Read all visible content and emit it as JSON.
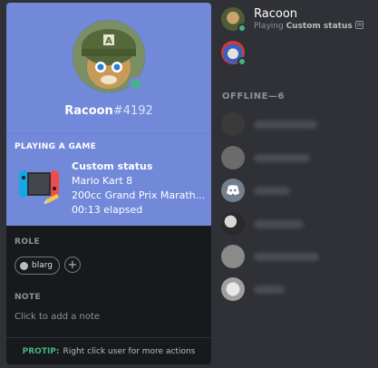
{
  "profile": {
    "username": "Racoon",
    "discriminator": "#4192",
    "status_color": "#43b581"
  },
  "activity": {
    "header": "PLAYING A GAME",
    "game_name": "Custom status",
    "details": "Mario Kart 8",
    "state": "200cc Grand Prix Marath...",
    "elapsed": "00:13 elapsed",
    "icon": "nintendo-switch-icon"
  },
  "role": {
    "label": "ROLE",
    "items": [
      "blarg"
    ],
    "add_icon": "+"
  },
  "note": {
    "label": "NOTE",
    "placeholder": "Click to add a note"
  },
  "protip": {
    "label": "PROTIP:",
    "text": "Right click user for more actions"
  },
  "members": {
    "online": [
      {
        "name": "Racoon",
        "activity_prefix": "Playing",
        "activity_name": "Custom status"
      },
      {
        "name": ""
      }
    ],
    "offline_header": "OFFLINE—6"
  },
  "colors": {
    "blurple": "#7289da",
    "online": "#43b581",
    "background": "#2f3136",
    "popout": "#18191c"
  }
}
